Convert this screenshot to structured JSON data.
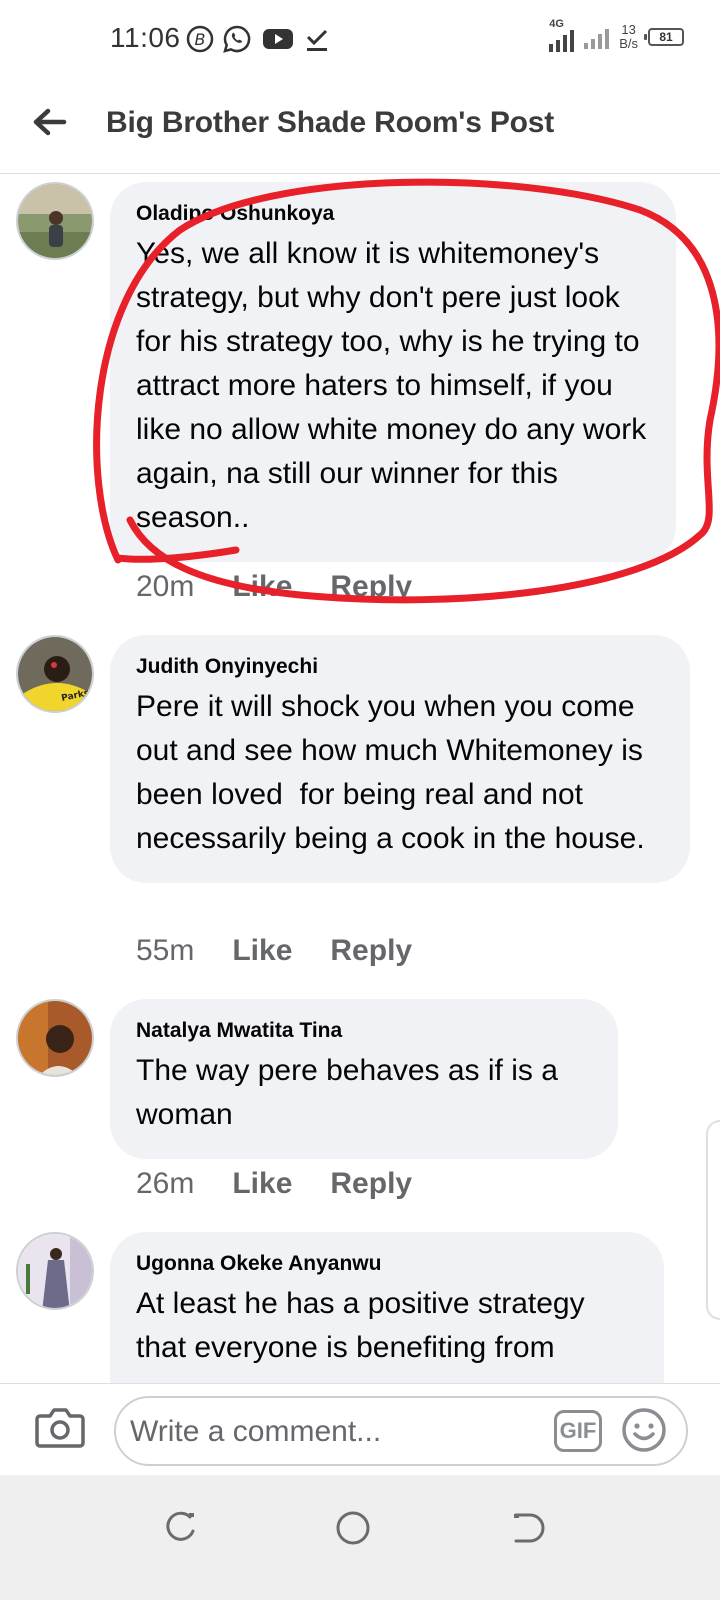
{
  "status_bar": {
    "time": "11:06",
    "network_label": "4G",
    "speed_value": "13",
    "speed_unit": "B/s",
    "battery": "81",
    "icons": [
      "b-circle-icon",
      "whatsapp-icon",
      "youtube-icon",
      "download-done-icon",
      "signal-icon",
      "signal-dim-icon",
      "battery-icon"
    ]
  },
  "header": {
    "title": "Big Brother Shade Room's Post"
  },
  "comments": [
    {
      "author": "Oladipo Oshunkoya",
      "text": "Yes, we all know it is whitemoney's strategy, but why don't pere just look for his strategy too, why is he trying to attract more haters to himself, if you like no allow white money do any work again, na still our winner for this season..",
      "time": "20m",
      "like_label": "Like",
      "reply_label": "Reply"
    },
    {
      "author": "Judith Onyinyechi",
      "text": "Pere it will shock you when you come out and see how much Whitemoney is been loved  for being real and not necessarily being a cook in the house.",
      "time": "55m",
      "like_label": "Like",
      "reply_label": "Reply"
    },
    {
      "author": "Natalya Mwatita Tina",
      "text": "The way pere behaves as if is a woman",
      "time": "26m",
      "like_label": "Like",
      "reply_label": "Reply"
    },
    {
      "author": "Ugonna Okeke Anyanwu",
      "text": "At least he has a positive strategy that everyone is benefiting from",
      "time": "",
      "like_label": "",
      "reply_label": ""
    }
  ],
  "composer": {
    "placeholder": "Write a comment...",
    "gif_label": "GIF"
  },
  "colors": {
    "bubble": "#f0f2f5",
    "meta_text": "#65676b",
    "annotation": "#e8202a"
  }
}
